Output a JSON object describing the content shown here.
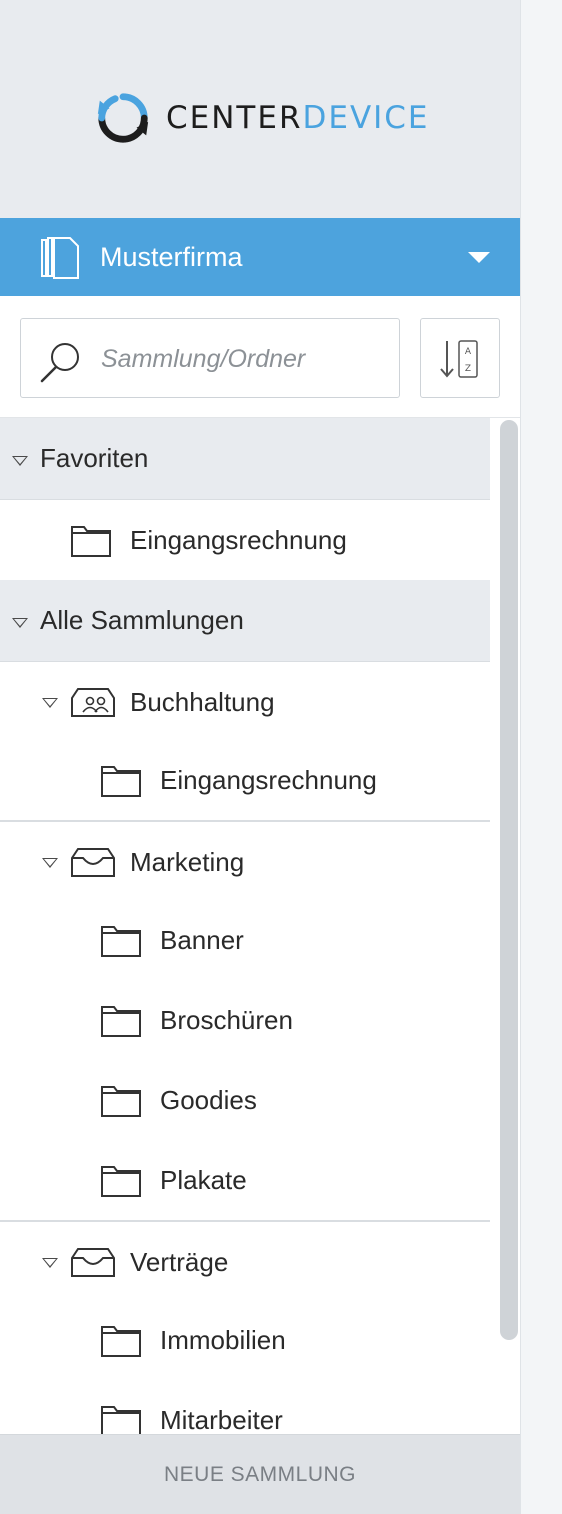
{
  "brand": {
    "center": "CENTER",
    "device": "DEVICE",
    "accent": "#4da3dd"
  },
  "org": {
    "name": "Musterfirma"
  },
  "search": {
    "placeholder": "Sammlung/Ordner",
    "value": ""
  },
  "sort_button": {
    "icon": "sort-az-icon"
  },
  "sections": {
    "favorites": {
      "label": "Favoriten",
      "items": [
        "Eingangsrechnung"
      ]
    },
    "all": {
      "label": "Alle Sammlungen"
    }
  },
  "collections": [
    {
      "name": "Buchhaltung",
      "icon": "shared-collection-icon",
      "folders": [
        "Eingangsrechnung"
      ]
    },
    {
      "name": "Marketing",
      "icon": "collection-tray-icon",
      "folders": [
        "Banner",
        "Broschüren",
        "Goodies",
        "Plakate"
      ]
    },
    {
      "name": "Verträge",
      "icon": "collection-tray-icon",
      "folders": [
        "Immobilien",
        "Mitarbeiter"
      ]
    }
  ],
  "footer": {
    "new_collection_label": "NEUE SAMMLUNG"
  }
}
